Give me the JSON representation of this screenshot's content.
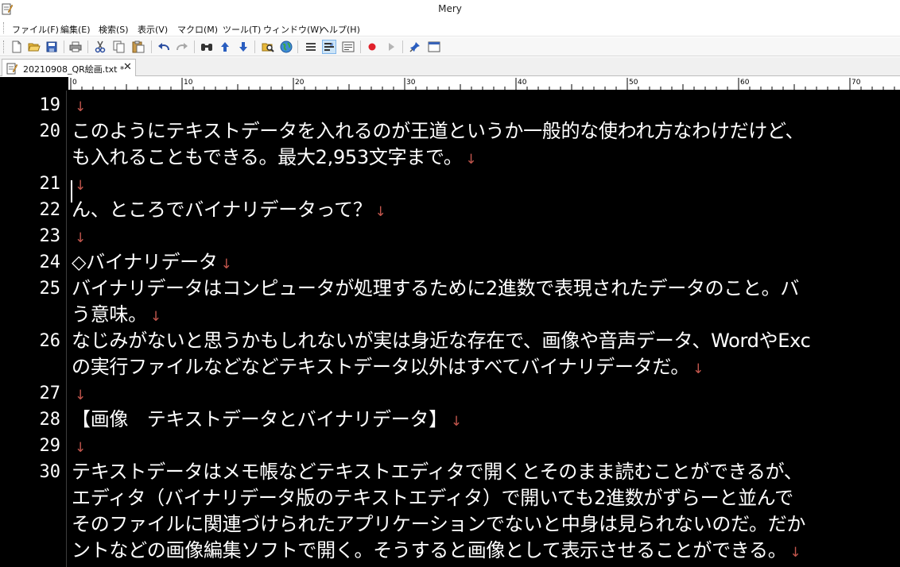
{
  "window": {
    "title": "Mery",
    "icon": "notepad-pencil-icon"
  },
  "menu": [
    {
      "label": "ファイル(F)"
    },
    {
      "label": "編集(E)"
    },
    {
      "label": "検索(S)"
    },
    {
      "label": "表示(V)"
    },
    {
      "label": "マクロ(M)"
    },
    {
      "label": "ツール(T)"
    },
    {
      "label": "ウィンドウ(W)"
    },
    {
      "label": "ヘルプ(H)"
    }
  ],
  "toolbar": [
    "new-file-icon",
    "open-folder-icon",
    "save-icon",
    "print-icon",
    "cut-icon",
    "copy-icon",
    "paste-icon",
    "undo-icon",
    "redo-icon",
    "find-icon",
    "find-previous-icon",
    "find-next-icon",
    "replace-files-icon",
    "web-search-icon",
    "wrap-none-icon",
    "wrap-window-icon",
    "wrap-page-icon",
    "record-macro-icon",
    "run-macro-icon",
    "pin-icon",
    "window-icon"
  ],
  "tab": {
    "title": "20210908_QR絵画.txt *",
    "close": "✕",
    "icon": "notepad-pencil-icon"
  },
  "ruler": {
    "labels": [
      "0",
      "10",
      "20",
      "30",
      "40",
      "50",
      "60",
      "70"
    ]
  },
  "editor": {
    "theme": {
      "background": "#000000",
      "text": "#ffffff",
      "eol_mark": "#c2564d"
    },
    "eol_mark": "↓",
    "lines": [
      {
        "num": "19",
        "text": "",
        "eol": true
      },
      {
        "num": "20",
        "text": "このようにテキストデータを入れるのが王道というか一般的な使われ方なわけだけど、",
        "eol": false
      },
      {
        "num": "",
        "text": "も入れることもできる。最大2,953文字まで。",
        "eol": true
      },
      {
        "num": "21",
        "text": "",
        "eol": true
      },
      {
        "num": "22",
        "text": "ん、ところでバイナリデータって？",
        "eol": true
      },
      {
        "num": "23",
        "text": "",
        "eol": true
      },
      {
        "num": "24",
        "text": "◇バイナリデータ",
        "eol": true
      },
      {
        "num": "25",
        "text": "バイナリデータはコンピュータが処理するために2進数で表現されたデータのこと。バ",
        "eol": false
      },
      {
        "num": "",
        "text": "う意味。",
        "eol": true
      },
      {
        "num": "26",
        "text": "なじみがないと思うかもしれないが実は身近な存在で、画像や音声データ、WordやExc",
        "eol": false
      },
      {
        "num": "",
        "text": "の実行ファイルなどなどテキストデータ以外はすべてバイナリデータだ。",
        "eol": true
      },
      {
        "num": "27",
        "text": "",
        "eol": true
      },
      {
        "num": "28",
        "text": "【画像　テキストデータとバイナリデータ】",
        "eol": true
      },
      {
        "num": "29",
        "text": "",
        "eol": true
      },
      {
        "num": "30",
        "text": "テキストデータはメモ帳などテキストエディタで開くとそのまま読むことができるが、",
        "eol": false
      },
      {
        "num": "",
        "text": "エディタ（バイナリデータ版のテキストエディタ）で開いても2進数がずらーと並んで",
        "eol": false
      },
      {
        "num": "",
        "text": "そのファイルに関連づけられたアプリケーションでないと中身は見られないのだ。だか",
        "eol": false
      },
      {
        "num": "",
        "text": "ントなどの画像編集ソフトで開く。そうすると画像として表示させることができる。",
        "eol": true
      }
    ]
  }
}
